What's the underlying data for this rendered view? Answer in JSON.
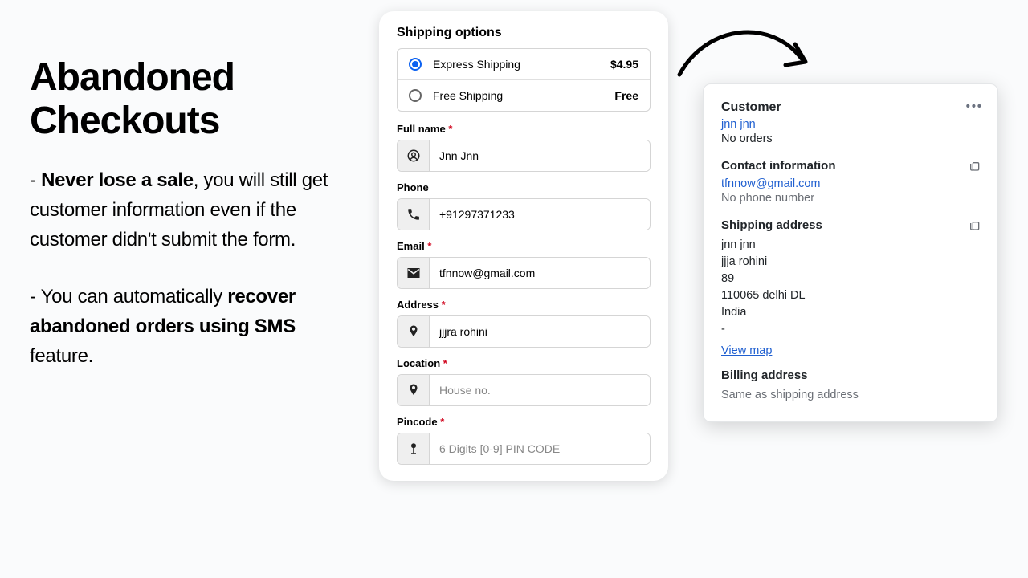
{
  "left": {
    "title": "Abandoned Checkouts",
    "p1_pre": "- ",
    "p1_bold": "Never lose a sale",
    "p1_post": ", you will still get customer information even if the customer didn't submit the form.",
    "p2_pre": "- You can automatically ",
    "p2_bold": "recover abandoned orders using SMS",
    "p2_post": " feature."
  },
  "checkout": {
    "shipping_title": "Shipping options",
    "options": [
      {
        "label": "Express Shipping",
        "price": "$4.95",
        "checked": true
      },
      {
        "label": "Free Shipping",
        "price": "Free",
        "checked": false
      }
    ],
    "fields": {
      "name": {
        "label": "Full name",
        "required": true,
        "value": "Jnn Jnn",
        "placeholder": ""
      },
      "phone": {
        "label": "Phone",
        "required": false,
        "value": "+91297371233",
        "placeholder": ""
      },
      "email": {
        "label": "Email",
        "required": true,
        "value": "tfnnow@gmail.com",
        "placeholder": ""
      },
      "address": {
        "label": "Address",
        "required": true,
        "value": "jjjra rohini",
        "placeholder": ""
      },
      "location": {
        "label": "Location",
        "required": true,
        "value": "",
        "placeholder": "House no."
      },
      "pincode": {
        "label": "Pincode",
        "required": true,
        "value": "",
        "placeholder": "6 Digits [0-9] PIN CODE"
      }
    },
    "required_mark": "*"
  },
  "customer": {
    "heading": "Customer",
    "name_link": "jnn jnn",
    "orders": "No orders",
    "contact_heading": "Contact information",
    "email": "tfnnow@gmail.com",
    "phone_note": "No phone number",
    "shipping_heading": "Shipping address",
    "addr": {
      "line1": "jnn jnn",
      "line2": "jjja rohini",
      "line3": "89",
      "line4": "110065 delhi DL",
      "line5": "India",
      "line6": "-"
    },
    "view_map": "View map",
    "billing_heading": "Billing address",
    "billing_note": "Same as shipping address"
  }
}
